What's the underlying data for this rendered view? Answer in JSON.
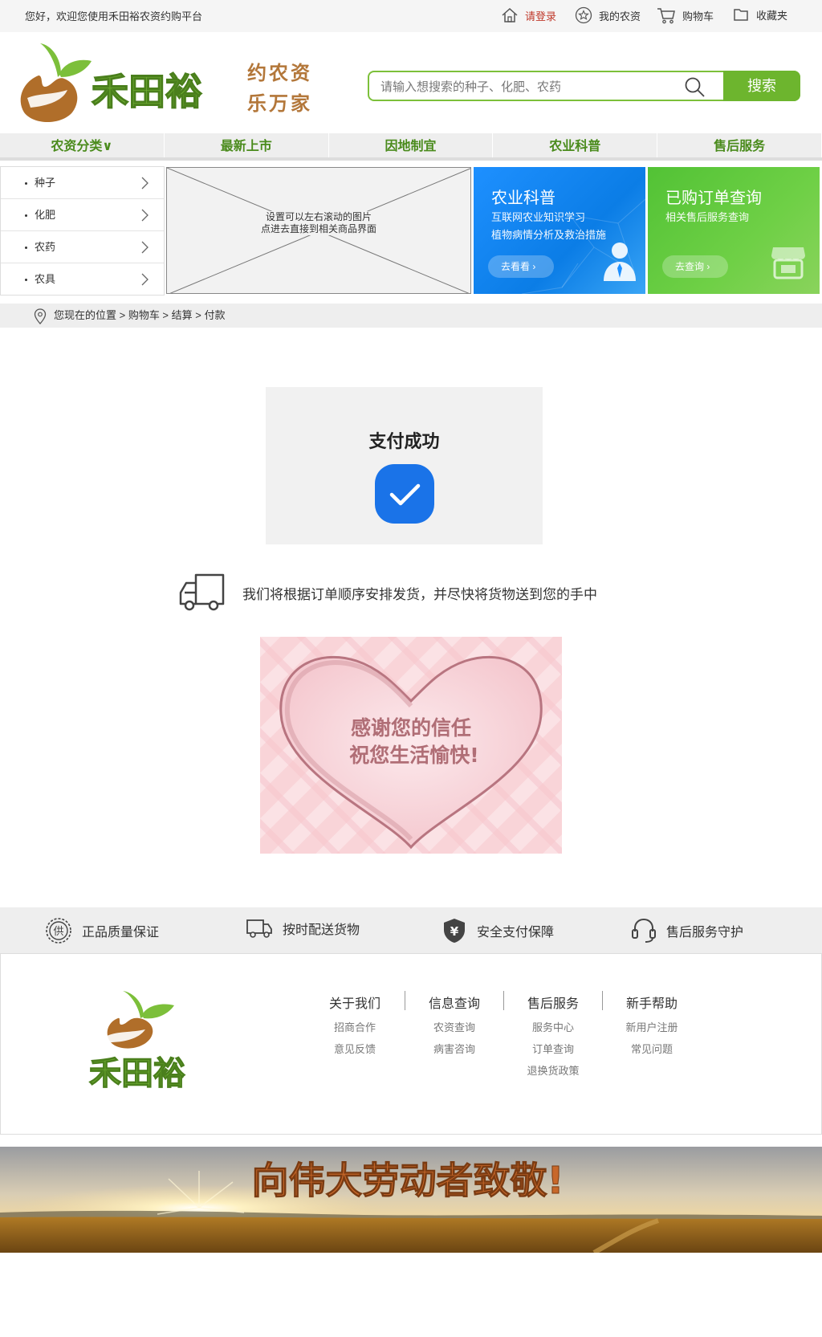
{
  "topbar": {
    "welcome": "您好，欢迎您使用禾田裕农资约购平台",
    "login": "请登录",
    "my_farm": "我的农资",
    "cart": "购物车",
    "favorites": "收藏夹"
  },
  "header": {
    "slogan_line1": "约农资",
    "slogan_line2": "乐万家",
    "search_placeholder": "请输入想搜索的种子、化肥、农药",
    "search_button": "搜索"
  },
  "nav": {
    "items": [
      "农资分类∨",
      "最新上市",
      "因地制宜",
      "农业科普",
      "售后服务"
    ]
  },
  "categories": [
    "种子",
    "化肥",
    "农药",
    "农具"
  ],
  "banner": {
    "line1": "设置可以左右滚动的图片",
    "line2": "点进去直接到相关商品界面"
  },
  "promo_blue": {
    "title": "农业科普",
    "line1": "互联网农业知识学习",
    "line2": "植物病情分析及救治措施",
    "button": "去看看 ›"
  },
  "promo_green": {
    "title": "已购订单查询",
    "line1": "相关售后服务查询",
    "button": "去查询 ›"
  },
  "breadcrumb": {
    "text": "您现在的位置 > 购物车 > 结算 > 付款"
  },
  "success": {
    "title": "支付成功"
  },
  "shipping": {
    "text": "我们将根据订单顺序安排发货，并尽快将货物送到您的手中"
  },
  "thanks": {
    "line1": "感谢您的信任",
    "line2": "祝您生活愉快!"
  },
  "guarantees": [
    {
      "icon": "quality-seal-icon",
      "label": "正品质量保证"
    },
    {
      "icon": "truck-icon",
      "label": "按时配送货物"
    },
    {
      "icon": "shield-yuan-icon",
      "label": "安全支付保障"
    },
    {
      "icon": "headset-icon",
      "label": "售后服务守护"
    }
  ],
  "footer": {
    "logo_text": "禾田裕",
    "columns": [
      {
        "heading": "关于我们",
        "links": [
          "招商合作",
          "意见反馈"
        ]
      },
      {
        "heading": "信息查询",
        "links": [
          "农资查询",
          "病害咨询"
        ]
      },
      {
        "heading": "售后服务",
        "links": [
          "服务中心",
          "订单查询",
          "退换货政策"
        ]
      },
      {
        "heading": "新手帮助",
        "links": [
          "新用户注册",
          "常见问题"
        ]
      }
    ]
  },
  "harvest_banner": {
    "text": "向伟大劳动者致敬!"
  },
  "logo": {
    "text": "禾田裕"
  },
  "colors": {
    "brand_green": "#6db52e",
    "nav_green": "#4a8b1c",
    "brand_brown": "#b3773a",
    "accent_blue": "#1a73e8",
    "login_red": "#c0392b"
  }
}
